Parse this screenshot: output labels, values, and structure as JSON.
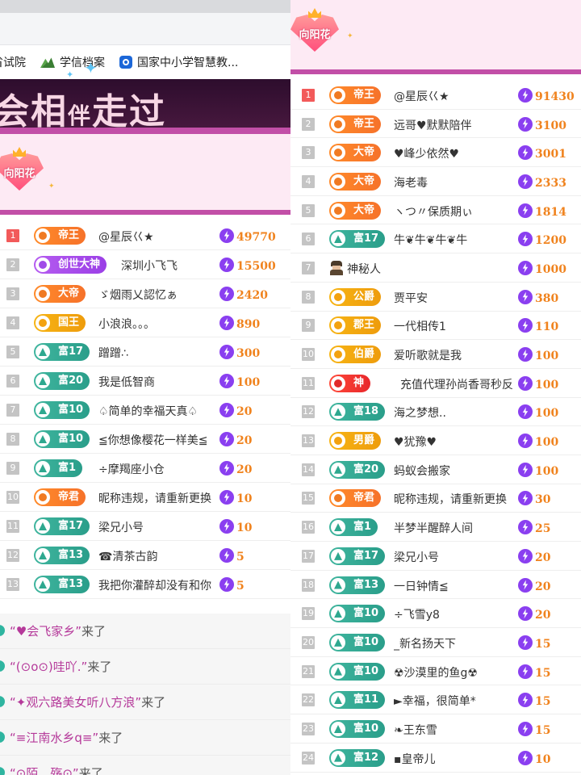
{
  "browser": {
    "bookmarks": [
      {
        "label": "省试院",
        "icon": "page-icon"
      },
      {
        "label": "学信档案",
        "icon": "xuexin-icon"
      },
      {
        "label": "国家中小学智慧教...",
        "icon": "edu-icon"
      }
    ]
  },
  "left": {
    "banner": {
      "part1": "会相",
      "part2": "伴",
      "part3": "走过"
    },
    "badge": "向阳花",
    "ranking": [
      {
        "rank": "1",
        "level": "帝王",
        "color": "orange",
        "name": "@星辰巜★",
        "score": "49770"
      },
      {
        "rank": "2",
        "level": "创世大神",
        "color": "purple",
        "name": "深圳小飞飞",
        "score": "15500"
      },
      {
        "rank": "3",
        "level": "大帝",
        "color": "orange",
        "name": "ゞ烟雨乂認忆ぁ",
        "score": "2420"
      },
      {
        "rank": "4",
        "level": "国王",
        "color": "gold",
        "name": "小浪浪。。。",
        "score": "890"
      },
      {
        "rank": "5",
        "level": "富17",
        "color": "green",
        "name": "蹭蹭∴",
        "score": "300"
      },
      {
        "rank": "6",
        "level": "富20",
        "color": "green",
        "name": "我是低智商",
        "score": "100"
      },
      {
        "rank": "7",
        "level": "富10",
        "color": "green",
        "name": "♤简单的幸福天真♤",
        "score": "20"
      },
      {
        "rank": "8",
        "level": "富10",
        "color": "green",
        "name": "≦你想像樱花一样美≦",
        "score": "20"
      },
      {
        "rank": "9",
        "level": "富1",
        "color": "green",
        "name": "÷摩羯座小仓",
        "score": "20"
      },
      {
        "rank": "10",
        "level": "帝君",
        "color": "orange",
        "name": "昵称违规，请重新更换",
        "score": "10"
      },
      {
        "rank": "11",
        "level": "富17",
        "color": "green",
        "name": "梁兄小号",
        "score": "10"
      },
      {
        "rank": "12",
        "level": "富13",
        "color": "green",
        "name": "☎清茶古韵",
        "score": "5"
      },
      {
        "rank": "13",
        "level": "富13",
        "color": "green",
        "name": "我把你灌醉却没有和你",
        "score": "5"
      }
    ],
    "chat": [
      {
        "nick": "“♥会飞家乡”",
        "suffix": "来了"
      },
      {
        "nick": "“(⊙o⊙)哇吖.”",
        "suffix": "来了"
      },
      {
        "nick": "“✦观六路美女听八方浪”",
        "suffix": "来了"
      },
      {
        "nick": "“≡江南水乡q≡”",
        "suffix": "来了"
      },
      {
        "nick": "“⊙陌、殇⊙”",
        "suffix": "来了"
      }
    ]
  },
  "right": {
    "badge": "向阳花",
    "ranking": [
      {
        "rank": "1",
        "level": "帝王",
        "color": "orange",
        "name": "@星辰巜★",
        "score": "91430"
      },
      {
        "rank": "2",
        "level": "帝王",
        "color": "orange",
        "name": "远哥♥默默陪伴",
        "score": "3100"
      },
      {
        "rank": "3",
        "level": "大帝",
        "color": "orange",
        "name": "♥峰少依然♥",
        "score": "3001"
      },
      {
        "rank": "4",
        "level": "大帝",
        "color": "orange",
        "name": "海老毒",
        "score": "2333"
      },
      {
        "rank": "5",
        "level": "大帝",
        "color": "orange",
        "name": "ヽつ〃保质期ぃ",
        "score": "1814"
      },
      {
        "rank": "6",
        "level": "富17",
        "color": "green",
        "name": "牛❦牛❦牛❦牛",
        "score": "1200"
      },
      {
        "rank": "7",
        "level": "",
        "color": "spy",
        "name": "神秘人",
        "score": "1000"
      },
      {
        "rank": "8",
        "level": "公爵",
        "color": "gold",
        "name": "贾平安",
        "score": "380"
      },
      {
        "rank": "9",
        "level": "郡王",
        "color": "gold",
        "name": "一代相传1",
        "score": "110"
      },
      {
        "rank": "10",
        "level": "伯爵",
        "color": "gold",
        "name": "爱听歌就是我",
        "score": "100"
      },
      {
        "rank": "11",
        "level": "神",
        "color": "red",
        "name": "充值代理孙尚香哥秒反",
        "score": "100"
      },
      {
        "rank": "12",
        "level": "富18",
        "color": "green",
        "name": "海之梦想..",
        "score": "100"
      },
      {
        "rank": "13",
        "level": "男爵",
        "color": "gold",
        "name": "♥犹豫♥",
        "score": "100"
      },
      {
        "rank": "14",
        "level": "富20",
        "color": "green",
        "name": "蚂蚁会搬家",
        "score": "100"
      },
      {
        "rank": "15",
        "level": "帝君",
        "color": "orange",
        "name": "昵称违规，请重新更换",
        "score": "30"
      },
      {
        "rank": "16",
        "level": "富1",
        "color": "green",
        "name": "半梦半醒醉人间",
        "score": "25"
      },
      {
        "rank": "17",
        "level": "富17",
        "color": "green",
        "name": "梁兄小号",
        "score": "20"
      },
      {
        "rank": "18",
        "level": "富13",
        "color": "green",
        "name": "一日钟情≦",
        "score": "20"
      },
      {
        "rank": "19",
        "level": "富10",
        "color": "green",
        "name": "÷飞雪y8",
        "score": "20"
      },
      {
        "rank": "20",
        "level": "富10",
        "color": "green",
        "name": "_新名扬天下",
        "score": "15"
      },
      {
        "rank": "21",
        "level": "富10",
        "color": "green",
        "name": "☢沙漠里的鱼g☢",
        "score": "15"
      },
      {
        "rank": "22",
        "level": "富11",
        "color": "green",
        "name": "►幸福，很简单*",
        "score": "15"
      },
      {
        "rank": "23",
        "level": "富10",
        "color": "green",
        "name": "❧王东雪",
        "score": "15"
      },
      {
        "rank": "24",
        "level": "富12",
        "color": "green",
        "name": "▪皇帝儿",
        "score": "10"
      }
    ]
  }
}
